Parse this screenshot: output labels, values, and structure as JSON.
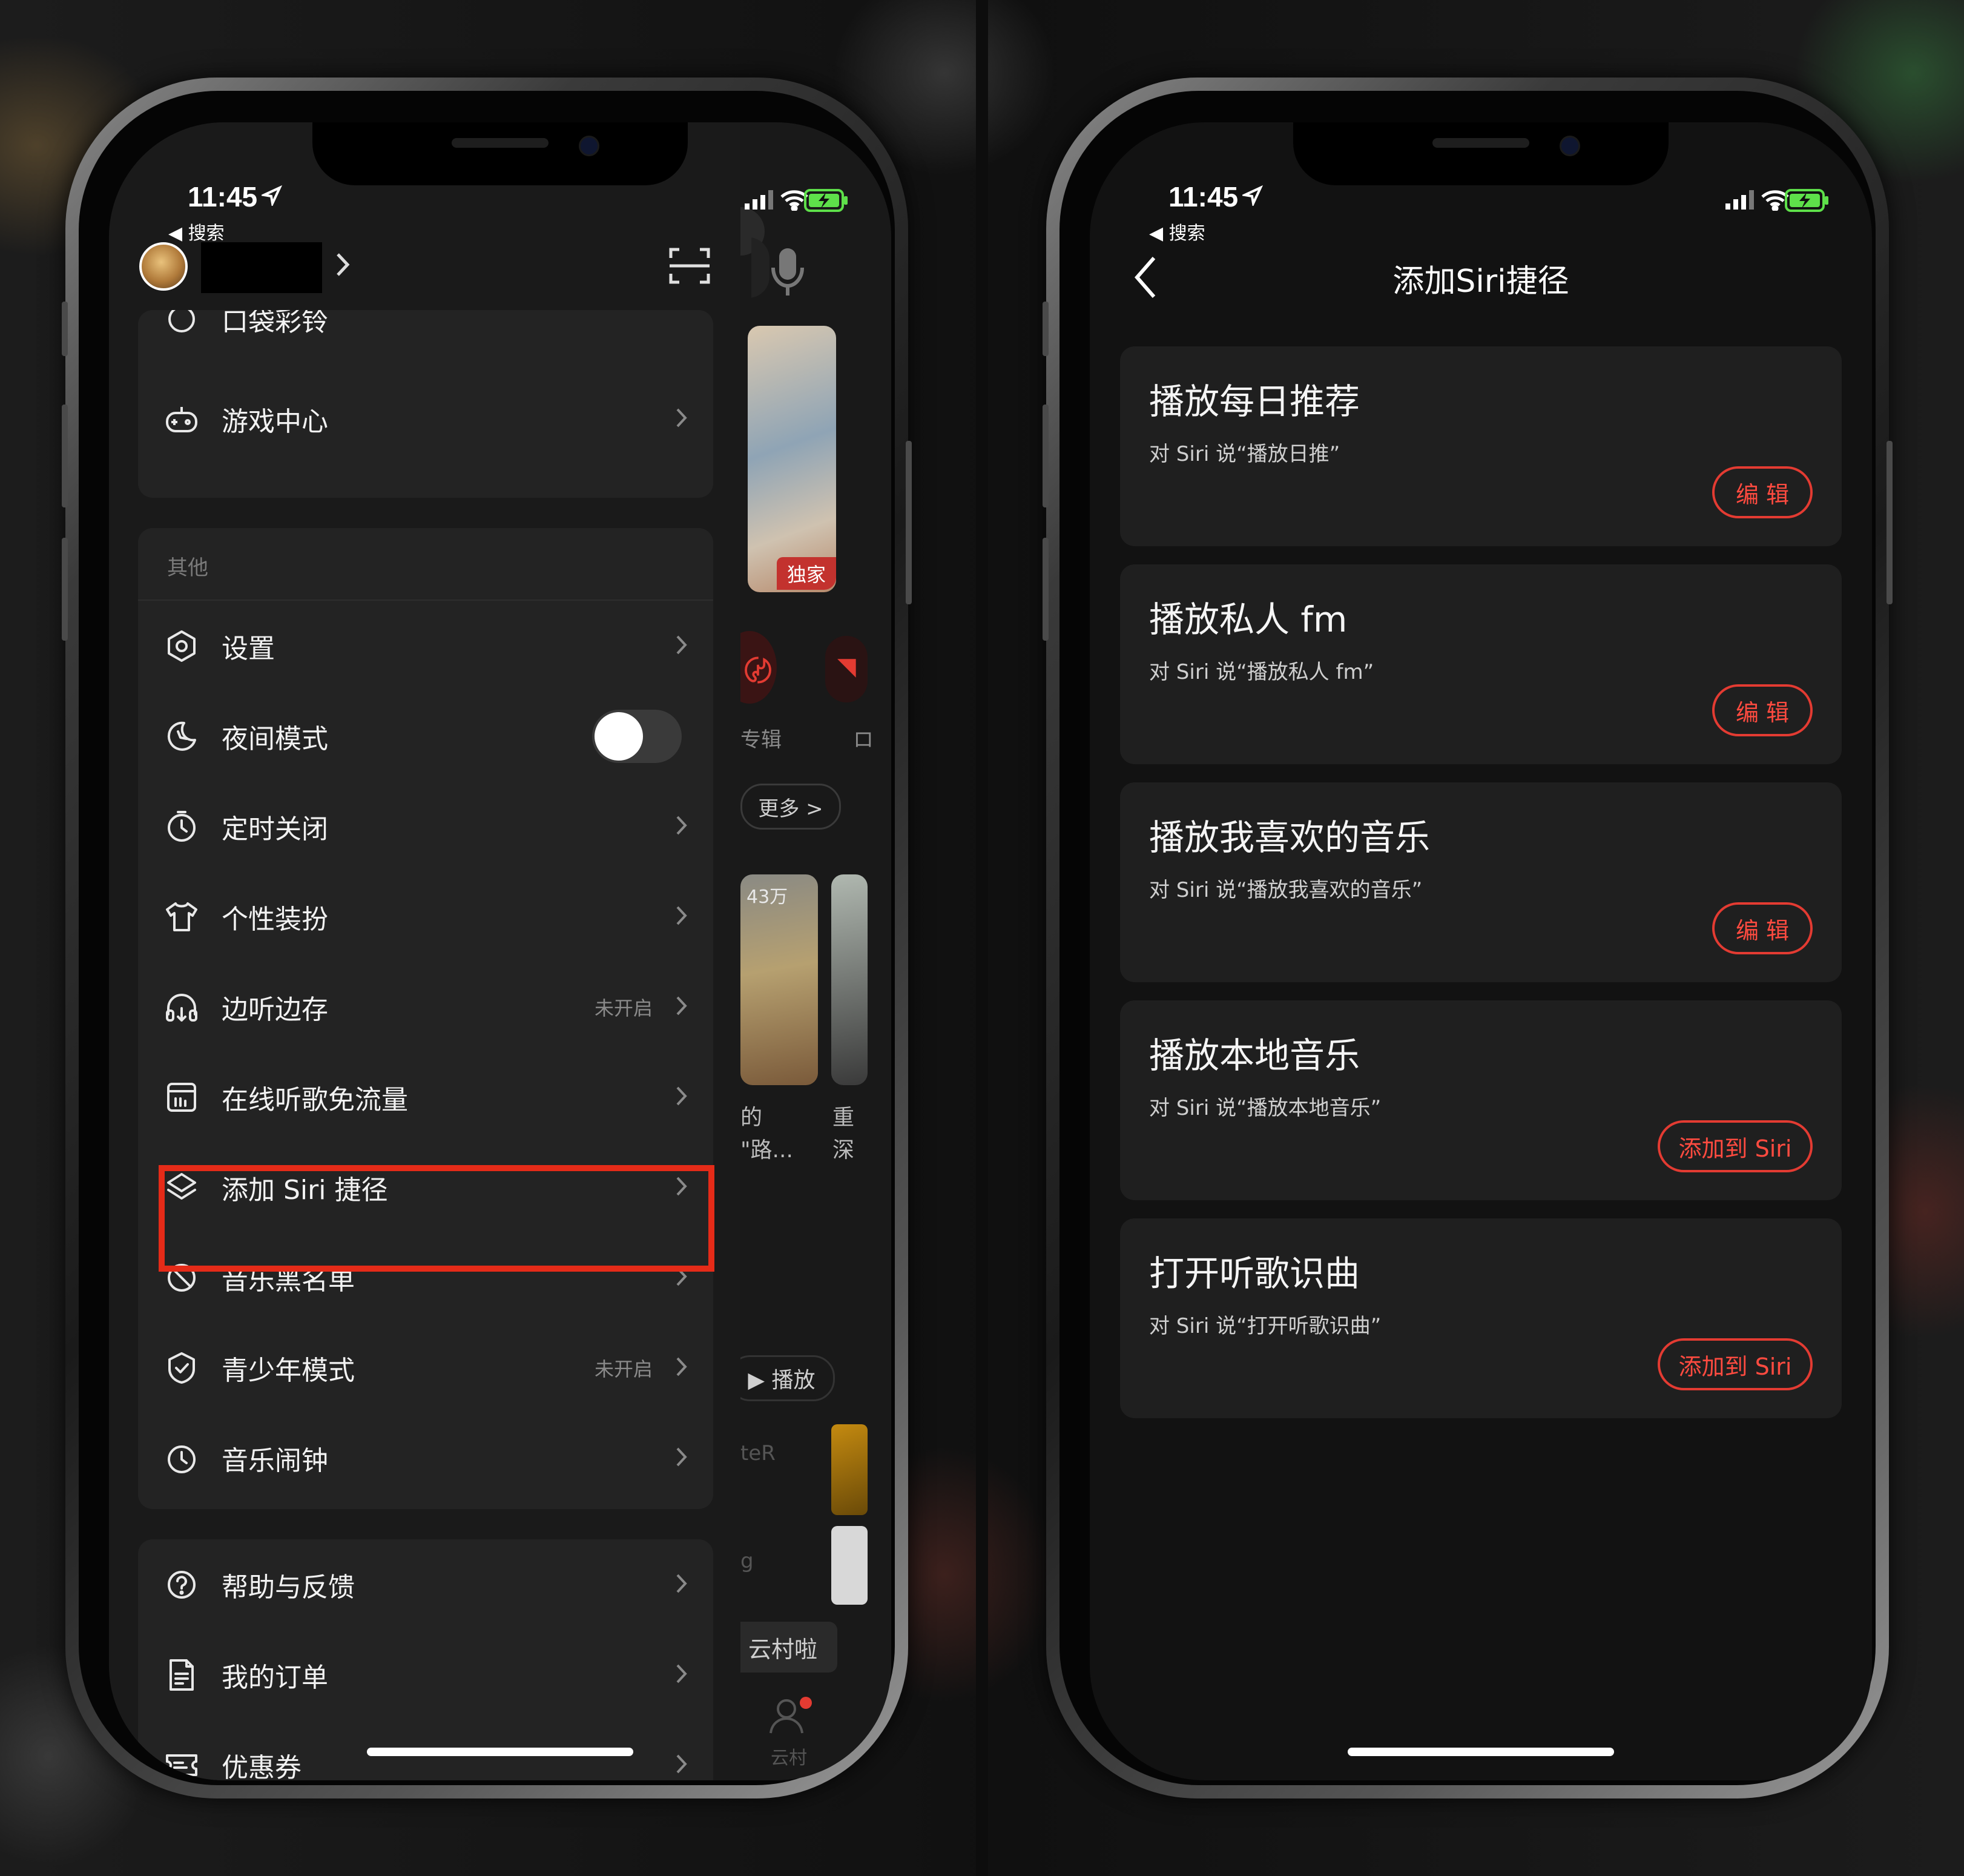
{
  "status_bar": {
    "time": "11:45",
    "back_app": "◀ 搜索"
  },
  "left_screen": {
    "header": {
      "username_redacted": "",
      "avatar": "avatar"
    },
    "partial_top_item": "口袋彩铃",
    "game_center": "游戏中心",
    "other_section": {
      "title": "其他",
      "items": [
        {
          "label": "设置",
          "icon": "settings-hexagon-icon",
          "note": ""
        },
        {
          "label": "夜间模式",
          "icon": "moon-icon",
          "note": "",
          "toggle": "off"
        },
        {
          "label": "定时关闭",
          "icon": "timer-icon",
          "note": ""
        },
        {
          "label": "个性装扮",
          "icon": "tshirt-icon",
          "note": ""
        },
        {
          "label": "边听边存",
          "icon": "headphone-download-icon",
          "note": "未开启"
        },
        {
          "label": "在线听歌免流量",
          "icon": "sim-card-icon",
          "note": ""
        },
        {
          "label": "添加 Siri 捷径",
          "icon": "layers-icon",
          "note": ""
        },
        {
          "label": "音乐黑名单",
          "icon": "blocked-icon",
          "note": ""
        },
        {
          "label": "青少年模式",
          "icon": "shield-check-icon",
          "note": "未开启"
        },
        {
          "label": "音乐闹钟",
          "icon": "alarm-clock-icon",
          "note": ""
        }
      ]
    },
    "bottom_section": {
      "items": [
        {
          "label": "帮助与反馈",
          "icon": "help-circle-icon"
        },
        {
          "label": "我的订单",
          "icon": "order-document-icon"
        },
        {
          "label": "优惠券",
          "icon": "coupon-icon"
        }
      ]
    },
    "background_peek": {
      "exclusive_badge": "独家",
      "album_label": "专辑",
      "more_button": "更多 >",
      "play_count": "43万",
      "text_1": "的",
      "text_2": "\"路...",
      "text_3": "重",
      "text_4": "深",
      "play_button": "▶ 播放",
      "text_5": "teR",
      "text_6": "g",
      "cloud_village_chip": "云村啦",
      "tab_cloud_village": "云村"
    }
  },
  "right_screen": {
    "title": "添加Siri捷径",
    "shortcuts": [
      {
        "title": "播放每日推荐",
        "phrase": "对 Siri 说“播放日推”",
        "button": "编 辑",
        "type": "edit"
      },
      {
        "title": "播放私人 fm",
        "phrase": "对 Siri 说“播放私人 fm”",
        "button": "编 辑",
        "type": "edit"
      },
      {
        "title": "播放我喜欢的音乐",
        "phrase": "对 Siri 说“播放我喜欢的音乐”",
        "button": "编 辑",
        "type": "edit"
      },
      {
        "title": "播放本地音乐",
        "phrase": "对 Siri 说“播放本地音乐”",
        "button": "添加到 Siri",
        "type": "add"
      },
      {
        "title": "打开听歌识曲",
        "phrase": "对 Siri 说“打开听歌识曲”",
        "button": "添加到 Siri",
        "type": "add"
      }
    ]
  },
  "colors": {
    "accent_red": "#e33b32",
    "highlight_red": "#e52b18",
    "battery_green": "#5ee04a"
  }
}
